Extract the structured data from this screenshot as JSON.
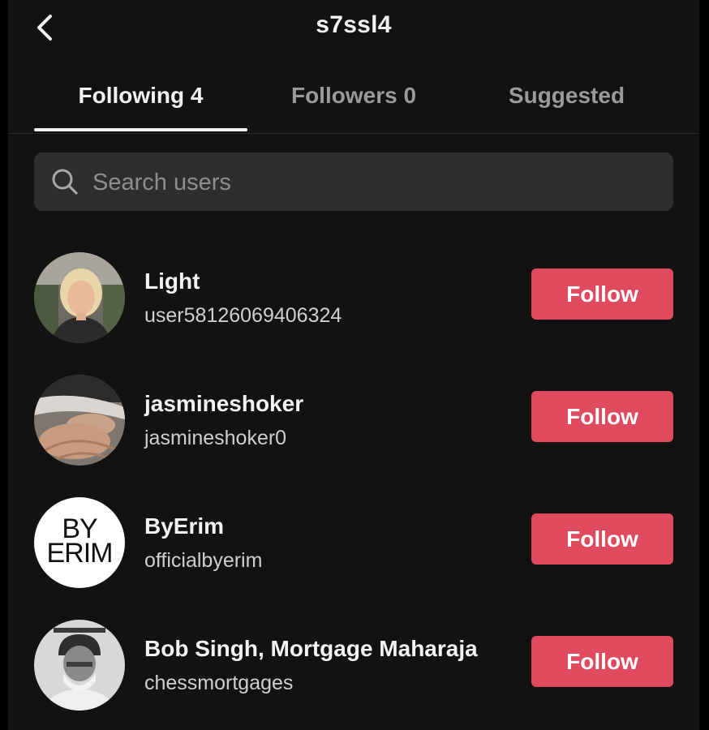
{
  "header": {
    "back_icon": "chevron-left-icon",
    "title": "s7ssl4"
  },
  "tabs": [
    {
      "label": "Following 4",
      "active": true
    },
    {
      "label": "Followers 0",
      "active": false
    },
    {
      "label": "Suggested",
      "active": false
    }
  ],
  "search": {
    "placeholder": "Search users",
    "value": "",
    "icon": "search-icon"
  },
  "users": [
    {
      "name": "Light",
      "handle": "user58126069406324",
      "button": "Follow",
      "avatar": "woman-portrait-photo"
    },
    {
      "name": "jasmineshoker",
      "handle": "jasmineshoker0",
      "button": "Follow",
      "avatar": "hands-photo"
    },
    {
      "name": "ByErim",
      "handle": "officialbyerim",
      "button": "Follow",
      "avatar": "byerim-logo",
      "avatar_text": [
        "BY",
        "ERIM"
      ]
    },
    {
      "name": "Bob Singh, Mortgage Maharaja",
      "handle": "chessmortgages",
      "button": "Follow",
      "avatar": "man-portrait-photo"
    }
  ],
  "colors": {
    "background": "#121212",
    "follow_button": "#e04a5f",
    "search_bg": "#2e2e2e"
  }
}
